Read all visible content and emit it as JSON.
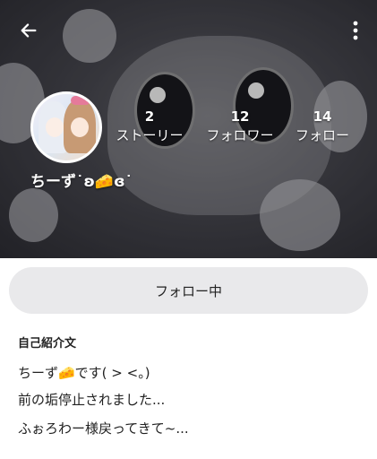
{
  "profile": {
    "username": "ちーず˙ʚ🧀ɞ˙",
    "stats": [
      {
        "count": "2",
        "label": "ストーリー"
      },
      {
        "count": "12",
        "label": "フォロワー"
      },
      {
        "count": "14",
        "label": "フォロー"
      }
    ]
  },
  "actions": {
    "follow_label": "フォロー中"
  },
  "bio": {
    "title": "自己紹介文",
    "lines": [
      "ちーず🧀です( > <。)",
      "前の垢停止されました...",
      "ふぉろわー様戻ってきて~..."
    ]
  },
  "icons": {
    "back": "arrow-left-icon",
    "more": "more-vertical-icon"
  }
}
